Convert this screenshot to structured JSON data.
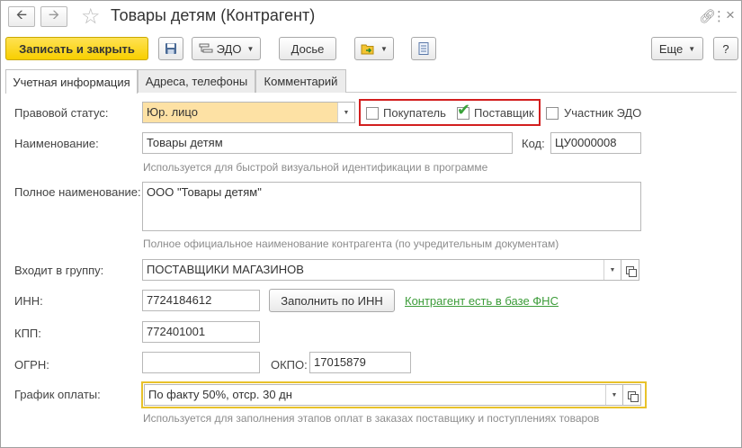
{
  "window": {
    "title": "Товары детям (Контрагент)",
    "nav_back_icon": "arrow-left-icon",
    "nav_forward_icon": "arrow-right-icon",
    "favorite_icon": "star-icon",
    "link_icon": "link-icon",
    "more_icon": "kebab-menu-icon",
    "close_icon": "close-icon"
  },
  "toolbar": {
    "save_close_label": "Записать и закрыть",
    "save_icon": "floppy-disk-icon",
    "edo_label": "ЭДО",
    "dossier_label": "Досье",
    "folder_icon": "folder-arrow-icon",
    "document_icon": "document-list-icon",
    "more_label": "Еще",
    "help_label": "?"
  },
  "tabs": [
    {
      "label": "Учетная информация",
      "active": true
    },
    {
      "label": "Адреса, телефоны",
      "active": false
    },
    {
      "label": "Комментарий",
      "active": false
    }
  ],
  "form": {
    "legal_status": {
      "label": "Правовой статус:",
      "value": "Юр. лицо"
    },
    "roles": {
      "buyer": {
        "label": "Покупатель",
        "checked": false
      },
      "supplier": {
        "label": "Поставщик",
        "checked": true
      },
      "edo_member": {
        "label": "Участник ЭДО",
        "checked": false
      }
    },
    "name": {
      "label": "Наименование:",
      "value": "Товары детям",
      "hint": "Используется для быстрой визуальной идентификации в программе"
    },
    "code": {
      "label": "Код:",
      "value": "ЦУ0000008"
    },
    "full_name": {
      "label": "Полное наименование:",
      "value": "ООО \"Товары детям\"",
      "hint": "Полное официальное наименование контрагента (по учредительным документам)"
    },
    "group": {
      "label": "Входит в группу:",
      "value": "ПОСТАВЩИКИ МАГАЗИНОВ"
    },
    "inn": {
      "label": "ИНН:",
      "value": "7724184612",
      "fill_button": "Заполнить по ИНН",
      "fns_link": "Контрагент есть в базе ФНС"
    },
    "kpp": {
      "label": "КПП:",
      "value": "772401001"
    },
    "ogrn": {
      "label": "ОГРН:",
      "value": ""
    },
    "okpo": {
      "label": "ОКПО:",
      "value": "17015879"
    },
    "payment_schedule": {
      "label": "График оплаты:",
      "value": "По факту 50%, отср. 30 дн",
      "hint": "Используется для заполнения этапов оплат в заказах поставщику и поступлениях товаров"
    }
  },
  "colors": {
    "accent_yellow": "#f8cf00",
    "focus_border": "#e8c22a",
    "highlight_field": "#fde1a4",
    "link_green": "#3c9c39",
    "check_green": "#3aa23a",
    "annotation_red": "#d21e1e"
  }
}
